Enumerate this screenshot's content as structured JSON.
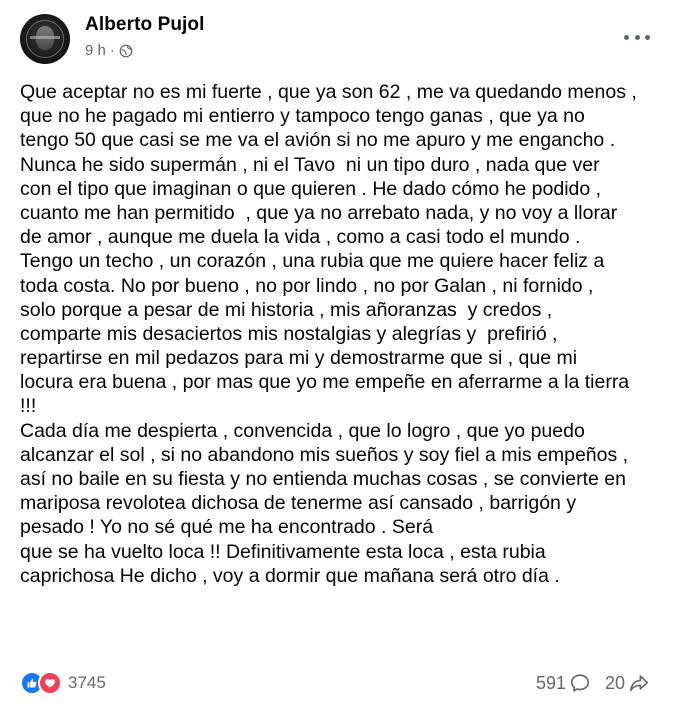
{
  "post": {
    "author": "Alberto Pujol",
    "time": "9 h",
    "separator": "·",
    "privacy_icon": "globe-icon",
    "menu_icon": "more-options-icon",
    "body_lines": [
      "Que aceptar no es mi fuerte , que ya son 62 , me va quedando menos ,",
      "que no he pagado mi entierro y tampoco tengo ganas , que ya no",
      "tengo 50 que casi se me va el avión si no me apuro y me engancho .",
      "Nunca he sido supermán , ni el Tavo  ni un tipo duro , nada que ver",
      "con el tipo que imaginan o que quieren . He dado cómo he podido ,",
      "cuanto me han permitido  , que ya no arrebato nada, y no voy a llorar",
      "de amor , aunque me duela la vida , como a casi todo el mundo .",
      "Tengo un techo , un corazón , una rubia que me quiere hacer feliz a",
      "toda costa. No por bueno , no por lindo , no por Galan , ni fornido ,",
      "solo porque a pesar de mi historia , mis añoranzas  y credos ,",
      "comparte mis desaciertos mis nostalgias y alegrías y  prefirió ,",
      "repartirse en mil pedazos para mi y demostrarme que si , que mi",
      "locura era buena , por mas que yo me empeñe en aferrarme a la tierra",
      "!!!",
      "Cada día me despierta , convencida , que lo logro , que yo puedo",
      "alcanzar el sol , si no abandono mis sueños y soy fiel a mis empeños ,",
      "así no baile en su fiesta y no entienda muchas cosas , se convierte en",
      "mariposa revolotea dichosa de tenerme así cansado , barrigón y",
      "pesado ! Yo no sé qué me ha encontrado . Será",
      "que se ha vuelto loca !! Definitivamente esta loca , esta rubia",
      "caprichosa He dicho , voy a dormir que mañana será otro día ."
    ]
  },
  "footer": {
    "reaction_icons": [
      "like-icon",
      "love-icon"
    ],
    "reaction_count": "3745",
    "comment_count": "591",
    "comment_icon": "comment-icon",
    "share_count": "20",
    "share_icon": "share-icon"
  },
  "colors": {
    "text": "#050505",
    "secondary_text": "#65676b",
    "like_blue": "#1877f2",
    "love_red": "#f33e58"
  }
}
